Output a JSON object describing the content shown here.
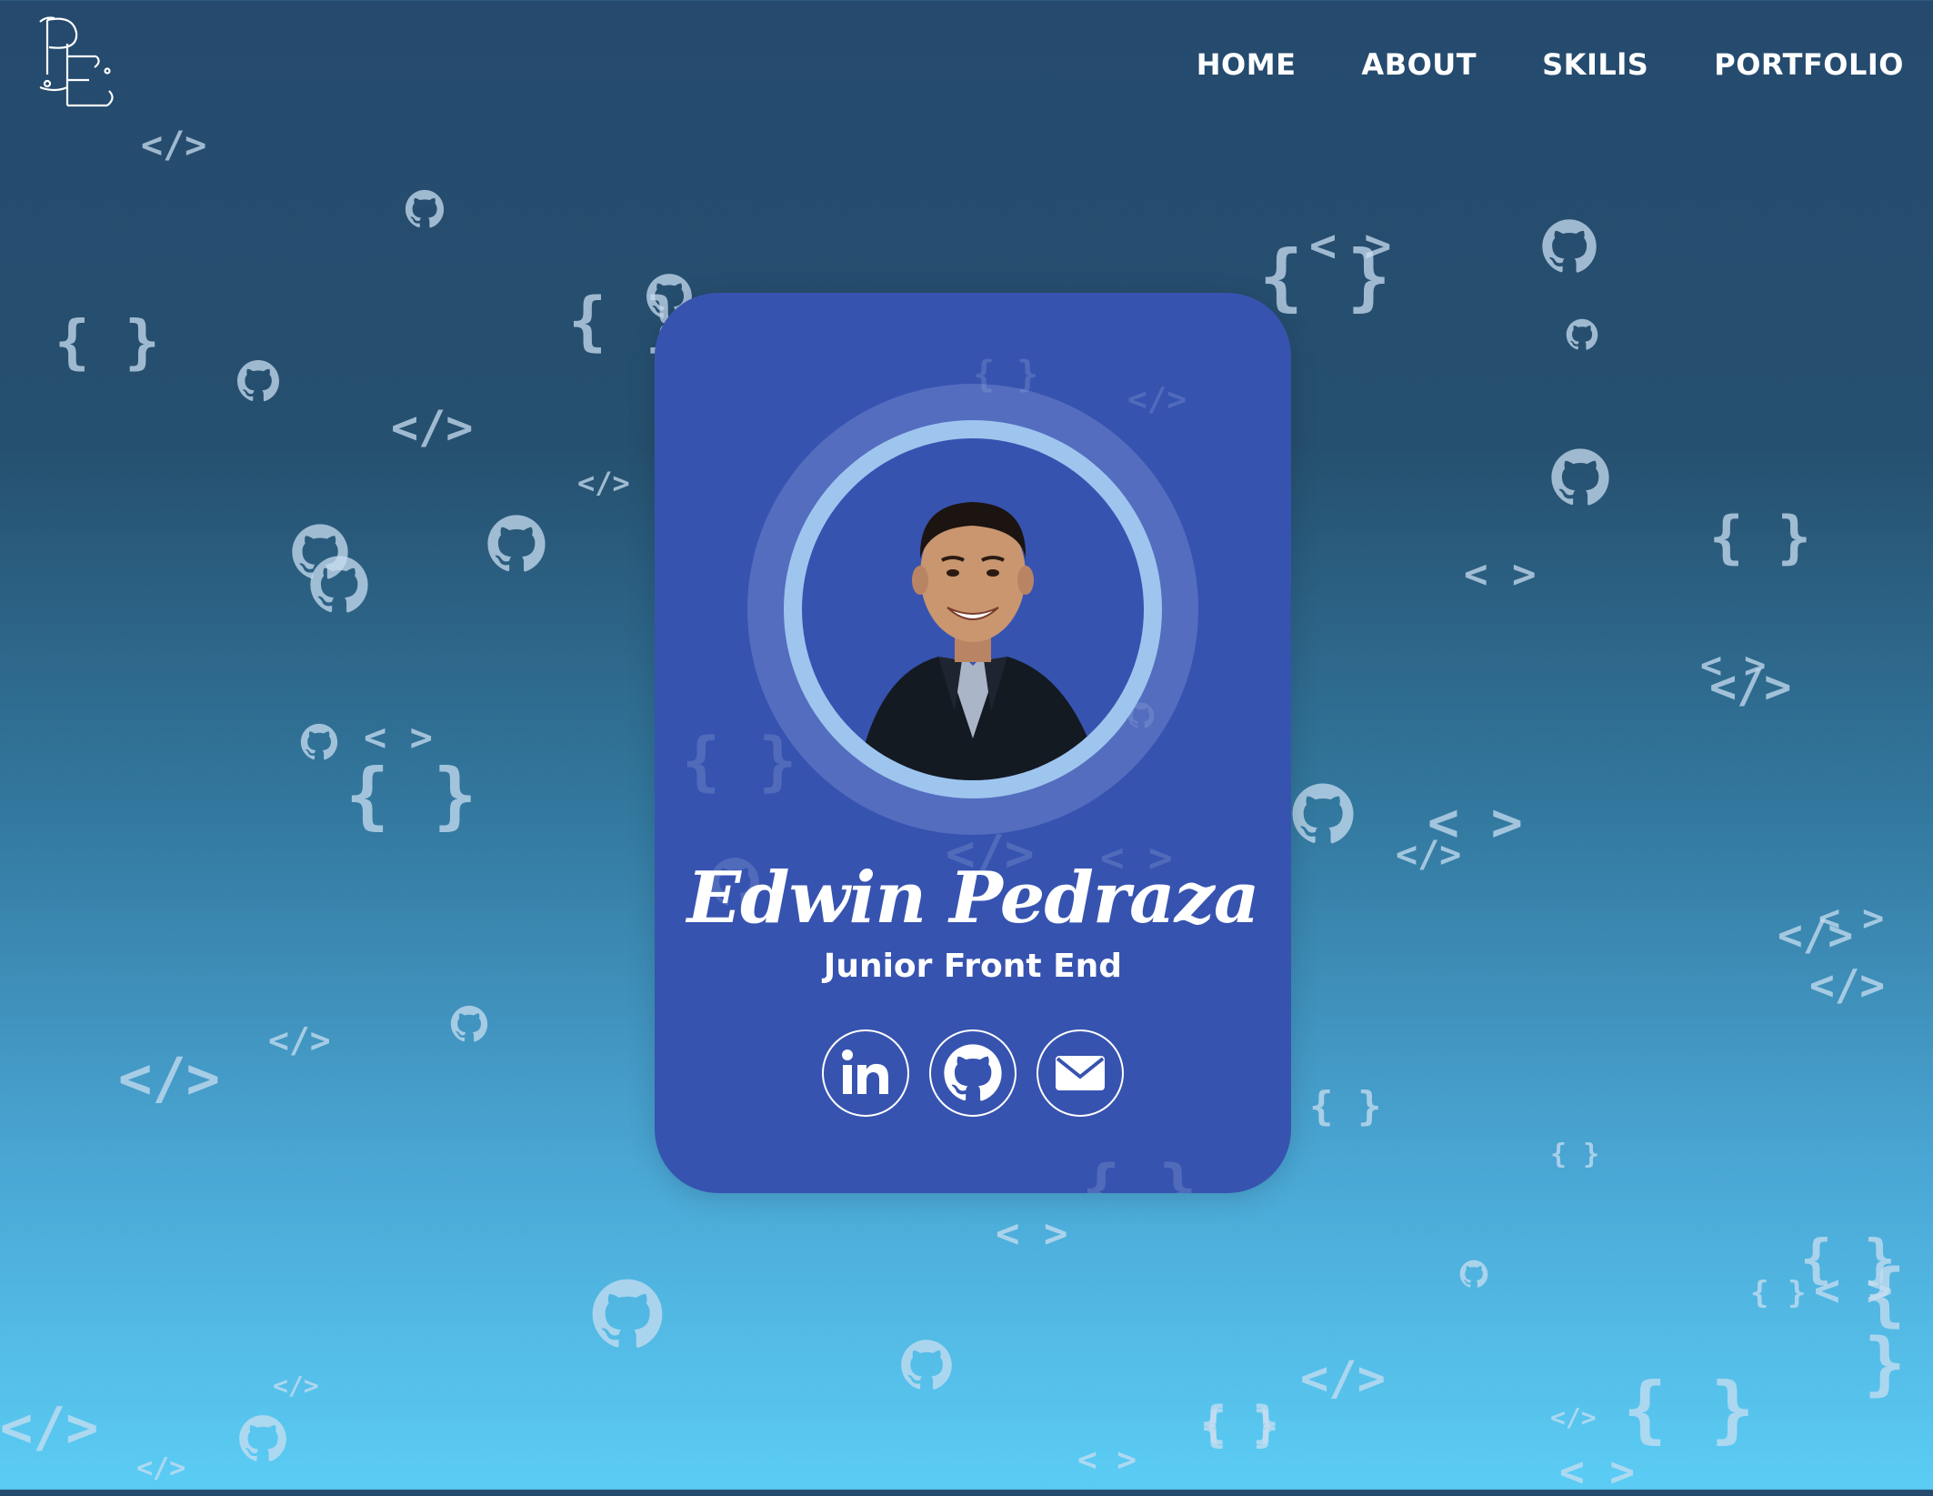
{
  "nav": {
    "logo_text": "PE",
    "items": [
      {
        "label": "HOME"
      },
      {
        "label": "ABOUT"
      },
      {
        "label": "SKILlS"
      },
      {
        "label": "PORTFOLIO"
      }
    ]
  },
  "profile": {
    "name": "Edwin Pedraza",
    "role": "Junior Front End"
  },
  "socials": [
    {
      "icon": "linkedin-icon"
    },
    {
      "icon": "github-icon"
    },
    {
      "icon": "mail-icon"
    }
  ],
  "background": {
    "decoration_symbols": [
      "</>",
      "{ }",
      "< >",
      "github-icon"
    ]
  },
  "colors": {
    "card": "#3753b0",
    "ring": "#9ec5ee",
    "bg_top": "#254a6e",
    "bg_bottom": "#5bcdf5"
  }
}
